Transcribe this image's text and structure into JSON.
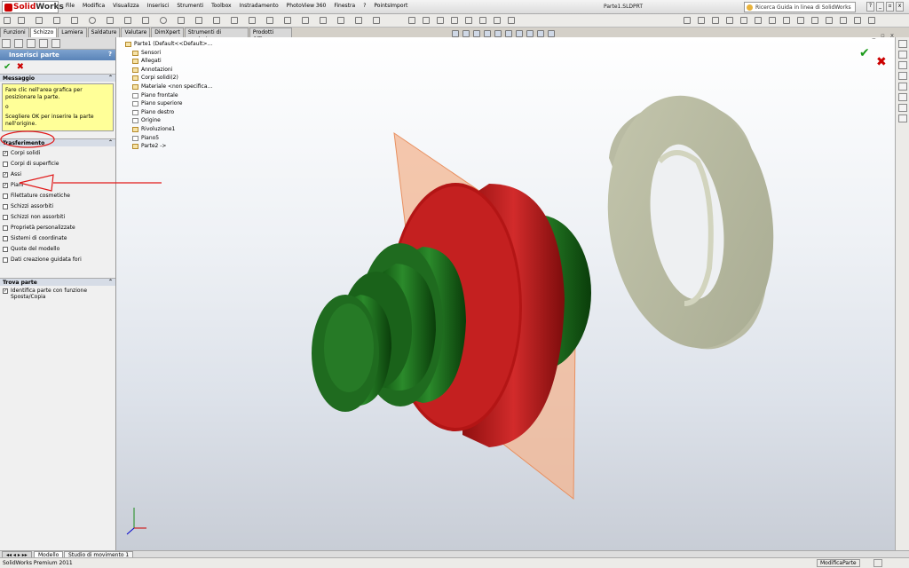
{
  "app": {
    "logo_prefix": "Solid",
    "logo_suffix": "Works",
    "document_title": "Parte1.SLDPRT",
    "search_placeholder": "Ricerca Guida in linea di SolidWorks"
  },
  "menu": [
    "File",
    "Modifica",
    "Visualizza",
    "Inserisci",
    "Strumenti",
    "Toolbox",
    "Instradamento",
    "PhotoView 360",
    "Finestra",
    "?",
    "PointsImport"
  ],
  "command_tabs": [
    "Funzioni",
    "Schizzo",
    "Lamiera",
    "Saldature",
    "Valutare",
    "DimXpert",
    "Strumenti di rendering",
    "Prodotti Office"
  ],
  "active_tab": "Schizzo",
  "property_manager": {
    "title": "Inserisci parte",
    "help": "?",
    "message_header": "Messaggio",
    "message_lines": [
      "Fare clic nell'area grafica per posizionare la parte.",
      "o",
      "Scegliere OK per inserire la parte nell'origine."
    ],
    "transfer_header": "Trasferimento",
    "transfer_items": [
      {
        "label": "Corpi solidi",
        "checked": true
      },
      {
        "label": "Corpi di superficie",
        "checked": false
      },
      {
        "label": "Assi",
        "checked": true
      },
      {
        "label": "Piani",
        "checked": true
      },
      {
        "label": "Filettature cosmetiche",
        "checked": false
      },
      {
        "label": "Schizzi assorbiti",
        "checked": false
      },
      {
        "label": "Schizzi non assorbiti",
        "checked": false
      },
      {
        "label": "Proprietà personalizzate",
        "checked": false
      },
      {
        "label": "Sistemi di coordinate",
        "checked": false
      },
      {
        "label": "Quote del modello",
        "checked": false
      },
      {
        "label": "Dati creazione guidata fori",
        "checked": false
      }
    ],
    "find_header": "Trova parte",
    "find_item": {
      "label": "Identifica parte con funzione Sposta/Copia",
      "checked": true
    }
  },
  "tree": {
    "root": "Parte1  (Default<<Default>...",
    "items": [
      "Sensori",
      "Allegati",
      "Annotazioni",
      "Corpi solidi(2)",
      "Materiale <non specifica...",
      "Piano frontale",
      "Piano superiore",
      "Piano destro",
      "Origine",
      "Rivoluzione1",
      "Piano5",
      "Parte2 ->"
    ]
  },
  "bottom_tabs": [
    "Modello",
    "Studio di movimento 1"
  ],
  "status": {
    "left": "SolidWorks Premium 2011",
    "right": "ModificaParte"
  },
  "colors": {
    "panel_title": "#5a84b8",
    "message_bg": "#ffff98",
    "annotation": "#e11a1a",
    "green_part": "#1f6b1f",
    "red_part": "#b31515",
    "ring": "#c9cbb4",
    "plane": "#f3b691"
  }
}
